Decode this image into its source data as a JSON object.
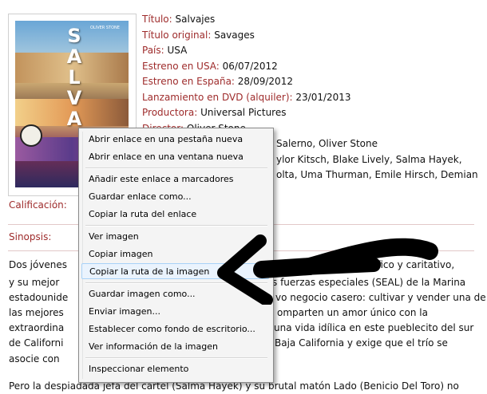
{
  "poster": {
    "letters": [
      "S",
      "A",
      "L",
      "V",
      "A"
    ],
    "small_left": "",
    "small_right": "OLIVER STONE"
  },
  "info": [
    {
      "label": "Título:",
      "value": "Salvajes"
    },
    {
      "label": "Título original:",
      "value": "Savages"
    },
    {
      "label": "País:",
      "value": "USA"
    },
    {
      "label": "Estreno en USA:",
      "value": "06/07/2012"
    },
    {
      "label": "Estreno en España:",
      "value": "28/09/2012"
    },
    {
      "label": "Lanzamiento en DVD (alquiler):",
      "value": "23/01/2013"
    },
    {
      "label": "Productora:",
      "value": "Universal Pictures"
    },
    {
      "label": "Director:",
      "value": "Oliver Stone"
    },
    {
      "label": "",
      "value": "Salerno, Oliver Stone"
    },
    {
      "label": "",
      "value": "ylor Kitsch, Blake Lively, Salma Hayek,"
    },
    {
      "label": "",
      "value": "olta, Uma Thurman, Emile Hirsch, Demian"
    }
  ],
  "calificacion_label": "Calificación:",
  "sinopsis_label": "Sinopsis:",
  "synopsis_lines": [
    {
      "left": "Dos jóvenes",
      "right": "nson), un budista pacífico y caritativo,"
    },
    {
      "left": "y su mejor",
      "right": "s fuerzas especiales (SEAL) de la Marina"
    },
    {
      "left": "estadounide",
      "right": "vo negocio casero: cultivar y vender una de"
    },
    {
      "left": "las mejores",
      "right": "omparten un amor único con la"
    },
    {
      "left": "extraordina",
      "right": "una vida idílica en este pueblecito del sur"
    },
    {
      "left": "de Californi",
      "right": "Baja California y exige que el trío se"
    },
    {
      "left": "asocie con",
      "right": ""
    }
  ],
  "last_line": "Pero la despiadada jefa del cártel (Salma Hayek) y su brutal matón Lado (Benicio Del Toro) no",
  "context_menu": {
    "groups": [
      [
        "Abrir enlace en una pestaña nueva",
        "Abrir enlace en una ventana nueva"
      ],
      [
        "Añadir este enlace a marcadores",
        "Guardar enlace como...",
        "Copiar la ruta del enlace"
      ],
      [
        "Ver imagen",
        "Copiar imagen",
        "Copiar la ruta de la imagen"
      ],
      [
        "Guardar imagen como...",
        "Enviar imagen...",
        "Establecer como fondo de escritorio...",
        "Ver información de la imagen"
      ],
      [
        "Inspeccionar elemento"
      ]
    ],
    "highlighted": "Copiar la ruta de la imagen"
  },
  "colors": {
    "label": "#9e2b2b",
    "menu_highlight": "#eaf3fd",
    "arrow": "#000000"
  }
}
